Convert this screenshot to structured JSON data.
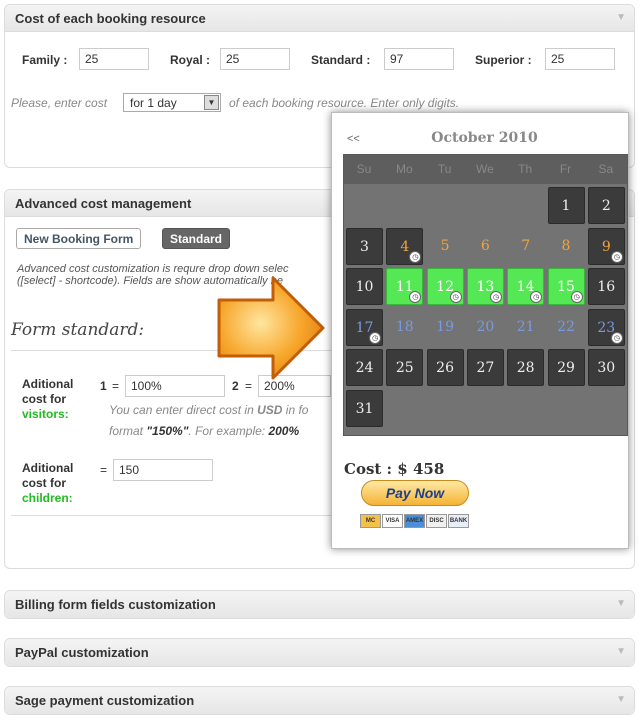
{
  "booking_resource_panel": {
    "title": "Cost of each booking resource",
    "resources": [
      {
        "label": "Family :",
        "value": "25"
      },
      {
        "label": "Royal :",
        "value": "25"
      },
      {
        "label": "Standard :",
        "value": "97"
      },
      {
        "label": "Superior :",
        "value": "25"
      }
    ],
    "note_before": "Please, enter cost",
    "period_selected": "for 1 day",
    "note_after": "of each booking resource. Enter only digits."
  },
  "advanced_panel": {
    "title": "Advanced cost management",
    "tab_new": "New Booking Form",
    "tab_standard": "Standard",
    "desc_line1": "Advanced cost customization is requre drop down selec",
    "desc_line2": "([select] - shortcode). Fields are show automatically he",
    "form_title": "Form standard:",
    "visitors_label_1": "Aditional",
    "visitors_label_2": "cost for",
    "visitors_label_3": "visitors:",
    "visitor_1_num": "1",
    "visitor_1_value": "100%",
    "visitor_2_num": "2",
    "visitor_2_value": "200%",
    "eq": "=",
    "visitors_note_1a": "You can enter direct cost in ",
    "visitors_note_1b": "USD",
    "visitors_note_1c": " in fo",
    "visitors_note_2a": "format ",
    "visitors_note_2b": "\"150%\"",
    "visitors_note_2c": ". For example: ",
    "visitors_note_2d": "200%",
    "children_label_1": "Aditional",
    "children_label_2": "cost for",
    "children_label_3": "children:",
    "children_value": "150"
  },
  "collapsed_panels": [
    {
      "title": "Billing form fields customization"
    },
    {
      "title": "PayPal customization"
    },
    {
      "title": "Sage payment customization"
    }
  ],
  "calendar": {
    "prev": "<<",
    "month": "October 2010",
    "weekdays": [
      "Su",
      "Mo",
      "Tu",
      "We",
      "Th",
      "Fr",
      "Sa"
    ],
    "days": [
      {
        "n": "1",
        "col": 5,
        "row": 0,
        "type": "dark"
      },
      {
        "n": "2",
        "col": 6,
        "row": 0,
        "type": "dark"
      },
      {
        "n": "3",
        "col": 0,
        "row": 1,
        "type": "dark"
      },
      {
        "n": "4",
        "col": 1,
        "row": 1,
        "type": "dark-orange",
        "clock": true
      },
      {
        "n": "5",
        "col": 2,
        "row": 1,
        "type": "orange"
      },
      {
        "n": "6",
        "col": 3,
        "row": 1,
        "type": "orange"
      },
      {
        "n": "7",
        "col": 4,
        "row": 1,
        "type": "orange"
      },
      {
        "n": "8",
        "col": 5,
        "row": 1,
        "type": "orange"
      },
      {
        "n": "9",
        "col": 6,
        "row": 1,
        "type": "dark-orange",
        "clock": true
      },
      {
        "n": "10",
        "col": 0,
        "row": 2,
        "type": "dark"
      },
      {
        "n": "11",
        "col": 1,
        "row": 2,
        "type": "green",
        "clock": true
      },
      {
        "n": "12",
        "col": 2,
        "row": 2,
        "type": "green",
        "clock": true
      },
      {
        "n": "13",
        "col": 3,
        "row": 2,
        "type": "green",
        "clock": true
      },
      {
        "n": "14",
        "col": 4,
        "row": 2,
        "type": "green",
        "clock": true
      },
      {
        "n": "15",
        "col": 5,
        "row": 2,
        "type": "green",
        "clock": true
      },
      {
        "n": "16",
        "col": 6,
        "row": 2,
        "type": "dark"
      },
      {
        "n": "17",
        "col": 0,
        "row": 3,
        "type": "dark-blue",
        "clock": true
      },
      {
        "n": "18",
        "col": 1,
        "row": 3,
        "type": "blue"
      },
      {
        "n": "19",
        "col": 2,
        "row": 3,
        "type": "blue"
      },
      {
        "n": "20",
        "col": 3,
        "row": 3,
        "type": "blue"
      },
      {
        "n": "21",
        "col": 4,
        "row": 3,
        "type": "blue"
      },
      {
        "n": "22",
        "col": 5,
        "row": 3,
        "type": "blue"
      },
      {
        "n": "23",
        "col": 6,
        "row": 3,
        "type": "dark-blue",
        "clock": true
      },
      {
        "n": "24",
        "col": 0,
        "row": 4,
        "type": "dark"
      },
      {
        "n": "25",
        "col": 1,
        "row": 4,
        "type": "dark"
      },
      {
        "n": "26",
        "col": 2,
        "row": 4,
        "type": "dark"
      },
      {
        "n": "27",
        "col": 3,
        "row": 4,
        "type": "dark"
      },
      {
        "n": "28",
        "col": 4,
        "row": 4,
        "type": "dark"
      },
      {
        "n": "29",
        "col": 5,
        "row": 4,
        "type": "dark"
      },
      {
        "n": "30",
        "col": 6,
        "row": 4,
        "type": "dark"
      },
      {
        "n": "31",
        "col": 0,
        "row": 5,
        "type": "dark"
      }
    ],
    "cost_text": "Cost : $ 458",
    "pay_button": "Pay Now",
    "cards": [
      "MC",
      "VISA",
      "AMEX",
      "DISC",
      "BANK"
    ]
  },
  "colors": {
    "accent_green": "#22bb22",
    "booked_green": "#55e855",
    "orange_day": "#f0a442",
    "blue_day": "#7a9adf",
    "arrow_orange": "#f0921a"
  }
}
